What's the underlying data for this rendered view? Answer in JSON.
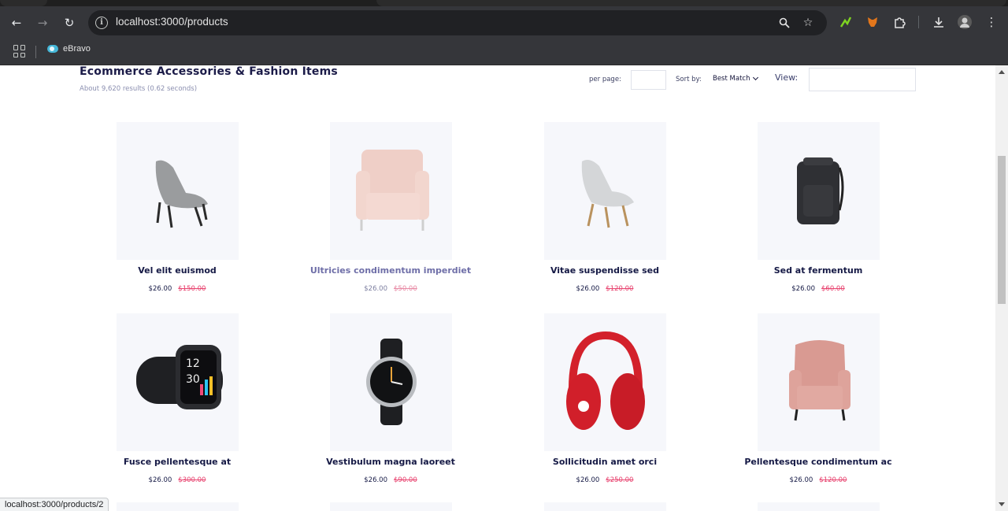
{
  "browser": {
    "url": "localhost:3000/products",
    "bookmark_label": "eBravo",
    "status_url": "localhost:3000/products/2"
  },
  "page": {
    "title": "Ecommerce Accessories & Fashion Items",
    "results": "About 9,620 results (0.62 seconds)",
    "per_page_label": "per page:",
    "sort_label": "Sort by:",
    "sort_value": "Best Match",
    "view_label": "View:"
  },
  "products": [
    {
      "name": "Vel elit euismod",
      "price": "$26.00",
      "old_price": "$150.00"
    },
    {
      "name": "Ultricies condimentum imperdiet",
      "price": "$26.00",
      "old_price": "$50.00"
    },
    {
      "name": "Vitae suspendisse sed",
      "price": "$26.00",
      "old_price": "$120.00"
    },
    {
      "name": "Sed at fermentum",
      "price": "$26.00",
      "old_price": "$60.00"
    },
    {
      "name": "Fusce pellentesque at",
      "price": "$26.00",
      "old_price": "$300.00"
    },
    {
      "name": "Vestibulum magna laoreet",
      "price": "$26.00",
      "old_price": "$90.00"
    },
    {
      "name": "Sollicitudin amet orci",
      "price": "$26.00",
      "old_price": "$250.00"
    },
    {
      "name": "Pellentesque condimentum ac",
      "price": "$26.00",
      "old_price": "$120.00"
    }
  ],
  "colors": {
    "title": "#1b1b48",
    "old_price": "#e8436f",
    "card_bg": "#f6f7fb"
  }
}
